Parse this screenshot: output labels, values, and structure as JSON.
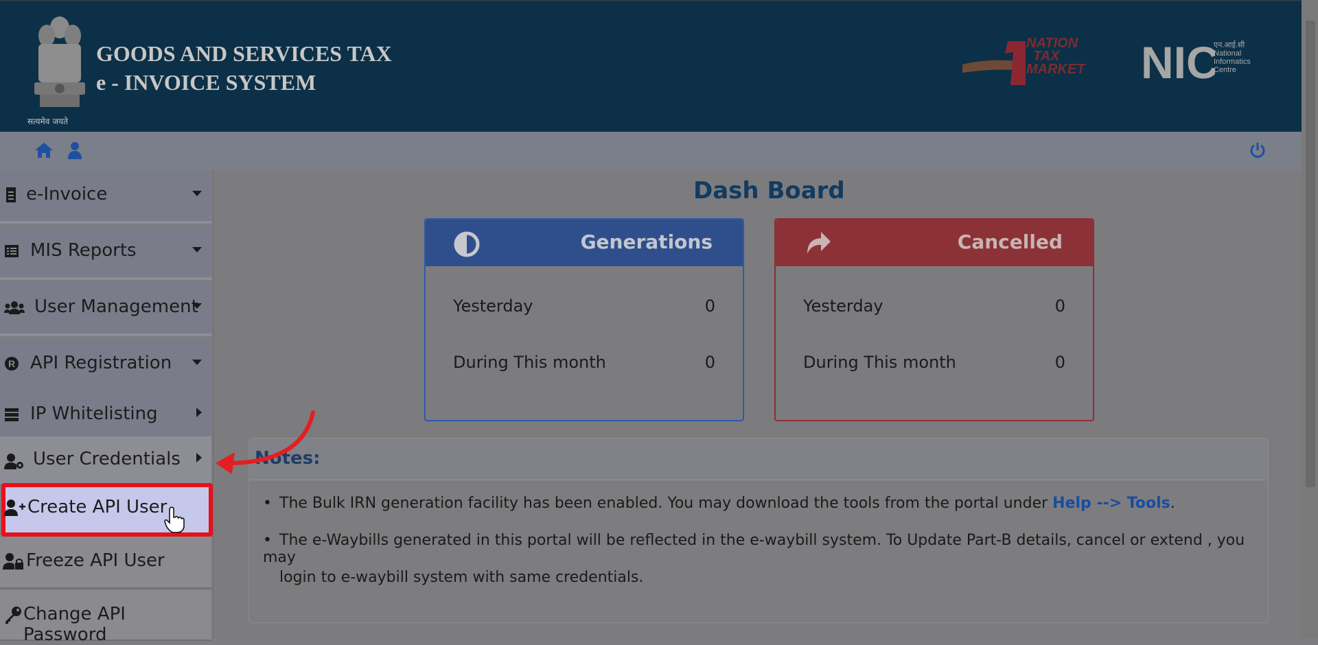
{
  "header": {
    "emblem_caption": "सत्यमेव जयते",
    "title_line1": "GOODS AND SERVICES TAX",
    "title_line2": "e - INVOICE SYSTEM",
    "partner_logo_lines": [
      "NATION",
      "TAX",
      "MARKET"
    ],
    "nic_logo": "NIC",
    "nic_text_lines": [
      "एन.आई.सी",
      "National",
      "Informatics",
      "Centre"
    ]
  },
  "toolbar": {
    "home_icon": "home-icon",
    "user_icon": "user-icon",
    "power_icon": "power-icon"
  },
  "sidebar": {
    "items": [
      {
        "label": "e-Invoice",
        "icon": "document-icon"
      },
      {
        "label": "MIS Reports",
        "icon": "report-icon"
      },
      {
        "label": "User Management",
        "icon": "users-icon"
      },
      {
        "label": "API Registration",
        "icon": "registered-icon"
      },
      {
        "label": "IP Whitelisting",
        "icon": "server-icon"
      },
      {
        "label": "User Credentials",
        "icon": "user-gear-icon"
      }
    ],
    "sub_items": [
      {
        "label": "Create API User",
        "icon": "user-plus-icon"
      },
      {
        "label": "Freeze API User",
        "icon": "user-lock-icon"
      },
      {
        "label": "Change API Password",
        "icon": "key-icon"
      }
    ]
  },
  "main": {
    "title": "Dash Board",
    "generations": {
      "title": "Generations",
      "rows": [
        {
          "label": "Yesterday",
          "value": "0"
        },
        {
          "label": "During This month",
          "value": "0"
        }
      ]
    },
    "cancelled": {
      "title": "Cancelled",
      "rows": [
        {
          "label": "Yesterday",
          "value": "0"
        },
        {
          "label": "During This month",
          "value": "0"
        }
      ]
    },
    "notes": {
      "title": "Notes:",
      "note1_text": "The Bulk IRN generation facility has been enabled. You may download the tools from the portal under ",
      "note1_link": "Help --> Tools",
      "note1_end": ".",
      "note2_line1": "The e-Waybills generated in this portal will be reflected in the e-waybill system. To Update Part-B details, cancel or extend , you may",
      "note2_line2": "login to e-waybill system with same credentials."
    }
  },
  "colors": {
    "header_bg": "#0c3047",
    "generations": "#2f4f8c",
    "cancelled": "#8c3236",
    "highlight": "#e8101a"
  }
}
